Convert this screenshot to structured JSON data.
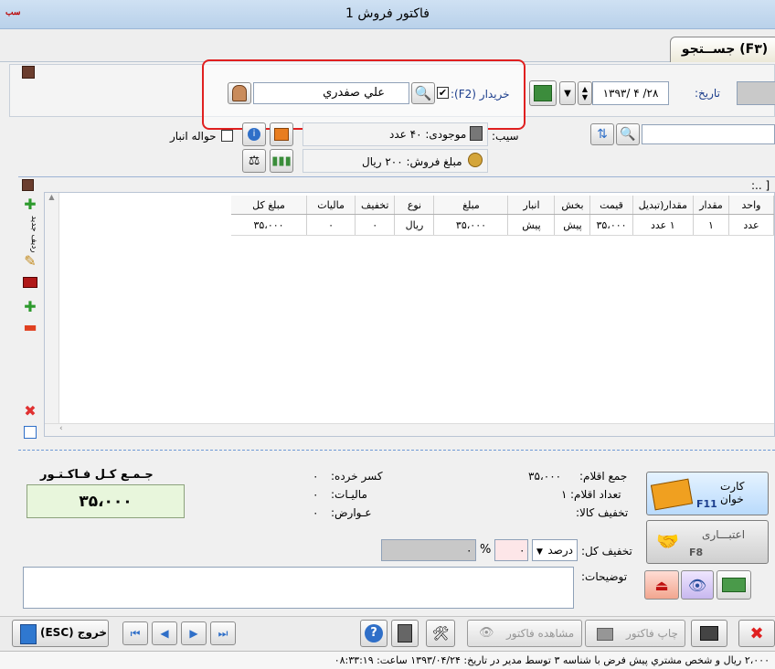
{
  "window": {
    "title": "فاکتور فروش 1",
    "app_badge": "سب"
  },
  "tabs": {
    "search": "جســتجو (F۳)"
  },
  "header": {
    "date_label": "تاریخ:",
    "date_value": "۱۳۹۳/ ۴ /۲۸",
    "buyer_label": "خریدار (F2):",
    "buyer_value": "علي صفدري"
  },
  "item": {
    "warehouse_transfer_label": "حواله انبار",
    "stock_label": "موجودی: ۴۰ عدد",
    "sell_price_label": "مبلغ فروش: ۲۰۰ ریال",
    "product_label_partial": "سیب:",
    "grid_caption_partial": "[ ..:"
  },
  "grid": {
    "columns": [
      "واحد",
      "مقدار",
      "مقدار(تبدیل",
      "قیمت",
      "بخش",
      "انبار",
      "مبلغ",
      "نوع",
      "تخفیف",
      "مالیات",
      "مبلغ کل"
    ],
    "rows": [
      [
        "عدد",
        "۱",
        "۱ عدد",
        "۳۵،۰۰۰",
        "پیش",
        "پیش",
        "۳۵،۰۰۰",
        "ریال",
        "۰",
        "۰",
        "۳۵،۰۰۰"
      ]
    ]
  },
  "sidebar": {
    "new_row_label": "ردیف جدید"
  },
  "summary": {
    "total_title": "جـمـع کـل فـاکـتـور",
    "total_value": "۳۵،۰۰۰",
    "items_sum_label": "جمع اقلام:",
    "items_sum_value": "۳۵،۰۰۰",
    "items_count_label": "تعداد اقلام:",
    "items_count_value": "۱",
    "goods_discount_label": "تخفیف کالا:",
    "rounding_label": "کسر خرده:",
    "rounding_value": "۰",
    "tax_label": "مالیـات:",
    "tax_value": "۰",
    "duties_label": "عـوارض:",
    "duties_value": "۰",
    "total_discount_label": "تخفیف کل:",
    "discount_type": "درصد",
    "discount_value": "۰",
    "percent_sign": "%",
    "discount_amount": "۰",
    "notes_label": "توضیحات:"
  },
  "payment": {
    "card_reader_label": "کارت خوان",
    "card_reader_key": "F11",
    "credit_label": "اعتبـــاری",
    "credit_key": "F8"
  },
  "toolbar": {
    "exit_label": "خروج (ESC)",
    "view_invoice_label": "مشاهده فاکتور",
    "print_invoice_label": "چاپ فاکتور"
  },
  "status": {
    "text": "۲،۰۰۰ ریال و شخص مشتري پیش فرض با شناسه ۳ توسط مدیر در تاریخ: ۱۳۹۳/۰۴/۲۴ ساعت: ۰۸:۳۳:۱۹"
  },
  "colors": {
    "highlight": "#e02020",
    "total_bg": "#e8f6dc",
    "accent_blue": "#2f6fc8",
    "card_button_bg": "#cfe7ff"
  }
}
